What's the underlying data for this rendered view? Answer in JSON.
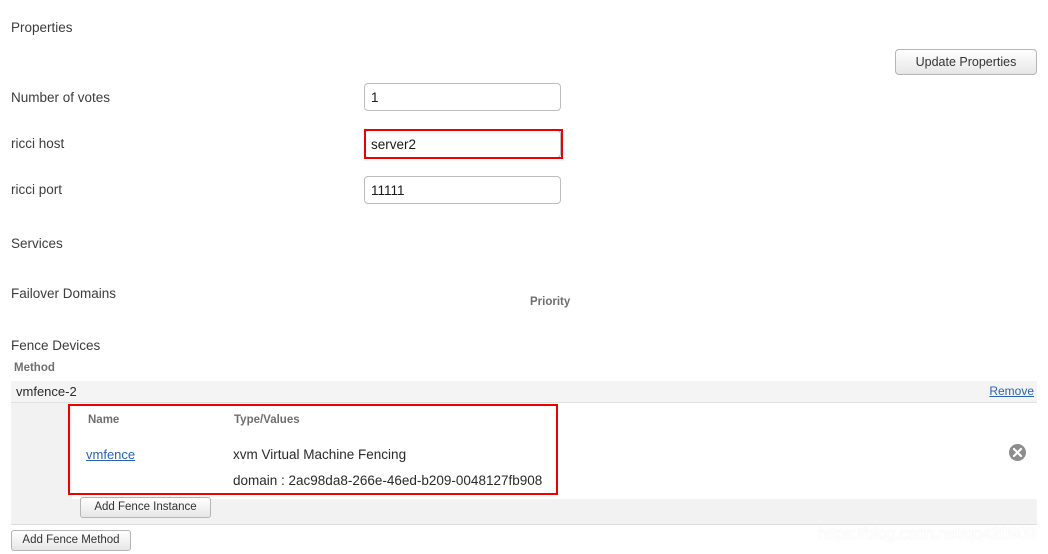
{
  "sections": {
    "properties_title": "Properties",
    "services_title": "Services",
    "failover_title": "Failover Domains",
    "fence_devices_title": "Fence Devices"
  },
  "toolbar": {
    "update_properties_label": "Update Properties"
  },
  "properties_form": {
    "fields": [
      {
        "label": "Number of votes",
        "value": "1",
        "highlighted": "false"
      },
      {
        "label": "ricci host",
        "value": "server2",
        "highlighted": "true"
      },
      {
        "label": "ricci port",
        "value": "11111",
        "highlighted": "false"
      }
    ]
  },
  "failover_domains": {
    "priority_header": "Priority"
  },
  "fence_devices": {
    "method_header": "Method",
    "method_name": "vmfence-2",
    "remove_link_label": "Remove",
    "instance_table": {
      "columns": [
        "Name",
        "Type/Values"
      ],
      "rows": [
        {
          "name": "vmfence",
          "type": "xvm Virtual Machine Fencing",
          "domain": "domain : 2ac98da8-266e-46ed-b209-0048127fb908"
        }
      ]
    },
    "add_instance_label": "Add Fence Instance",
    "add_method_label": "Add Fence Method"
  },
  "watermark": {
    "text": "https://blog.csdn.net/qq420909"
  },
  "colors": {
    "annotation_red": "#ee0000",
    "link_blue": "#2a63b5",
    "header_gray": "#6f6f6f",
    "row_background": "#f4f4f4",
    "panel_background": "#f2f2f2"
  }
}
